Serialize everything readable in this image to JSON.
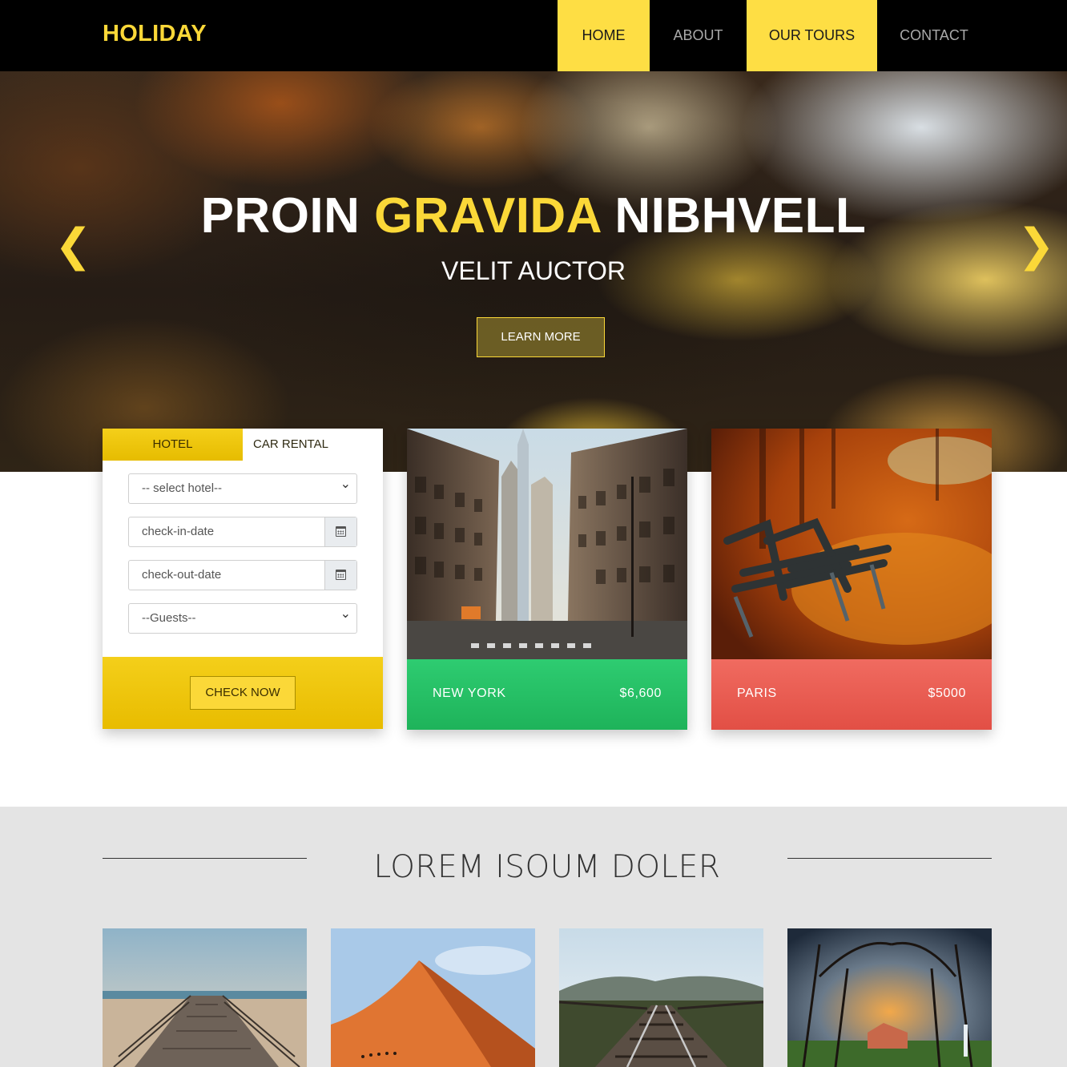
{
  "brand": {
    "logo": "HOLIDAY"
  },
  "nav": {
    "items": [
      {
        "label": "HOME",
        "active": true
      },
      {
        "label": "ABOUT",
        "active": false
      },
      {
        "label": "OUR TOURS",
        "active": true
      },
      {
        "label": "CONTACT",
        "active": false
      }
    ]
  },
  "hero": {
    "title_pre": "PROIN ",
    "title_highlight": "GRAVIDA",
    "title_post": " NIBHVELL",
    "subtitle": "VELIT AUCTOR",
    "button": "LEARN MORE",
    "prev_icon": "chevron-left-icon",
    "next_icon": "chevron-right-icon",
    "prev_glyph": "❮",
    "next_glyph": "❯"
  },
  "booking": {
    "tabs": [
      "HOTEL",
      "CAR RENTAL"
    ],
    "hotel_select": "-- select hotel--",
    "checkin_placeholder": "check-in-date",
    "checkout_placeholder": "check-out-date",
    "guests_select": "--Guests--",
    "submit": "CHECK NOW"
  },
  "destinations": [
    {
      "name": "NEW YORK",
      "price": "$6,600",
      "color": "#2ecc71"
    },
    {
      "name": "PARIS",
      "price": "$5000",
      "color": "#e74c3c"
    }
  ],
  "section": {
    "title": "LOREM ISOUM DOLER"
  },
  "colors": {
    "accent": "#fede44",
    "nav_bg": "#000000",
    "section_bg": "#e4e4e4"
  }
}
